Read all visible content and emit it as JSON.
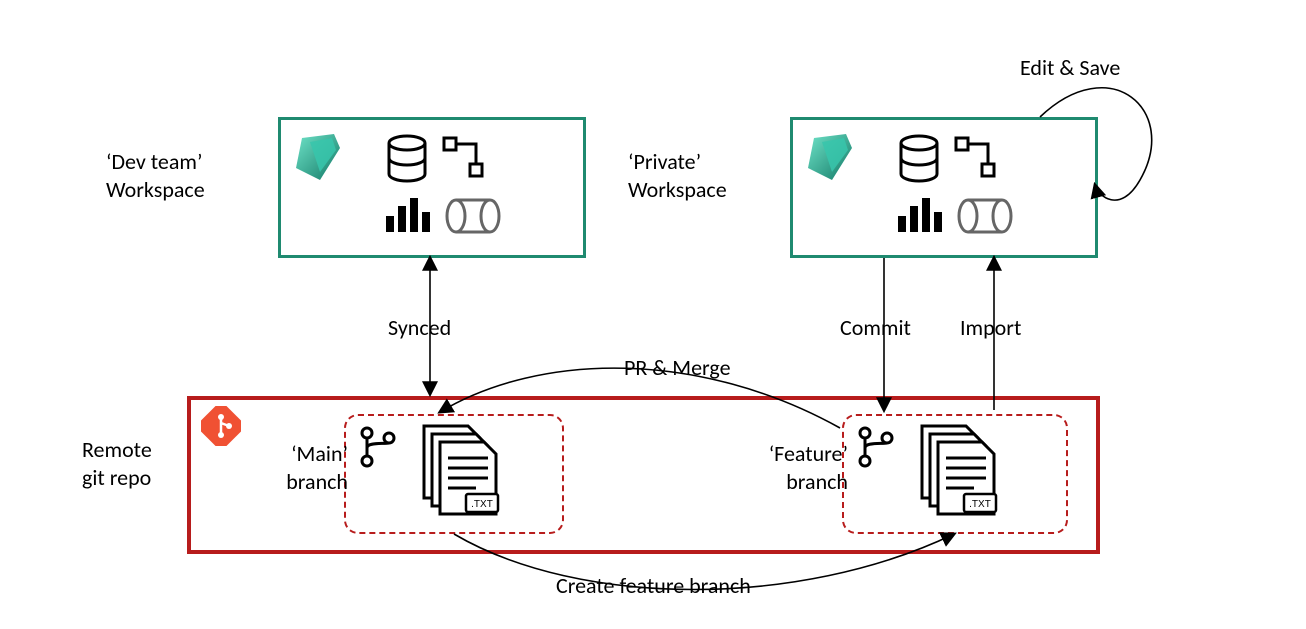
{
  "labels": {
    "dev_workspace_line1": "‘Dev team’",
    "dev_workspace_line2": "Workspace",
    "private_workspace_line1": "‘Private’",
    "private_workspace_line2": "Workspace",
    "remote_repo_line1": "Remote",
    "remote_repo_line2": "git repo",
    "main_branch_line1": "‘Main’",
    "main_branch_line2": "branch",
    "feature_branch_line1": "‘Feature’",
    "feature_branch_line2": "branch",
    "synced": "Synced",
    "commit": "Commit",
    "import": "Import",
    "edit_save": "Edit & Save",
    "pr_merge": "PR & Merge",
    "create_branch": "Create feature branch"
  },
  "colors": {
    "workspace_border": "#1f8a70",
    "repo_border": "#b71c1c",
    "branch_dash": "#b71c1c",
    "git_orange": "#f05133",
    "fabric_teal_a": "#37c6ab",
    "fabric_teal_b": "#117865"
  },
  "icons": {
    "fabric": "fabric-logo-icon",
    "database": "database-icon",
    "pipeline": "pipeline-icon",
    "bar_chart": "bar-chart-icon",
    "lakehouse": "lakehouse-cylinder-icon",
    "git": "git-icon",
    "branch": "git-branch-icon",
    "files": "txt-files-stack-icon"
  }
}
